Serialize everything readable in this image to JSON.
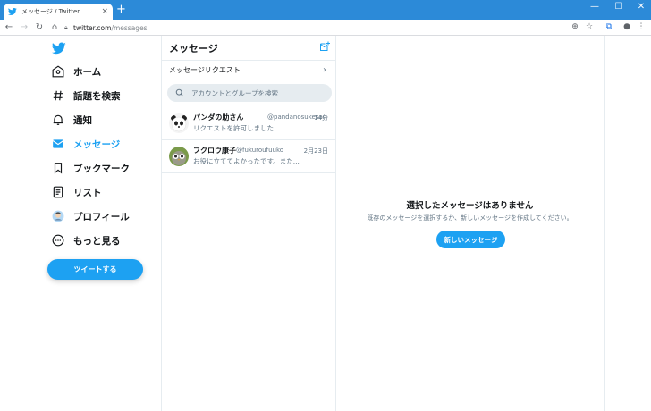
{
  "browser": {
    "tab_title": "メッセージ / Twitter",
    "tab_close": "×",
    "new_tab": "+",
    "url_host": "twitter.com",
    "url_path": "/messages",
    "win_min": "—",
    "win_max": "☐",
    "win_close": "✕"
  },
  "sidebar": {
    "items": [
      {
        "label": "ホーム",
        "icon": "home-icon"
      },
      {
        "label": "話題を検索",
        "icon": "hashtag-icon"
      },
      {
        "label": "通知",
        "icon": "bell-icon"
      },
      {
        "label": "メッセージ",
        "icon": "mail-icon",
        "active": true
      },
      {
        "label": "ブックマーク",
        "icon": "bookmark-icon"
      },
      {
        "label": "リスト",
        "icon": "list-icon"
      },
      {
        "label": "プロフィール",
        "icon": "avatar-icon"
      },
      {
        "label": "もっと見る",
        "icon": "more-icon"
      }
    ],
    "tweet_button": "ツイートする"
  },
  "messages": {
    "title": "メッセージ",
    "requests_label": "メッセージリクエスト",
    "requests_chevron": "›",
    "search_placeholder": "アカウントとグループを検索",
    "conversations": [
      {
        "name": "パンダの助さん",
        "handle": "@pandanosukesan",
        "time": "14分",
        "preview": "リクエストを許可しました"
      },
      {
        "name": "フクロウ康子",
        "handle": "@fukuroufuuko",
        "time": "2月23日",
        "preview": "お役に立ててよかったです。また..."
      }
    ]
  },
  "detail": {
    "empty_title": "選択したメッセージはありません",
    "empty_subtitle": "既存のメッセージを選択するか、新しいメッセージを作成してください。",
    "new_message_button": "新しいメッセージ"
  },
  "colors": {
    "accent": "#1da1f2",
    "titlebar": "#2c8ad8"
  }
}
